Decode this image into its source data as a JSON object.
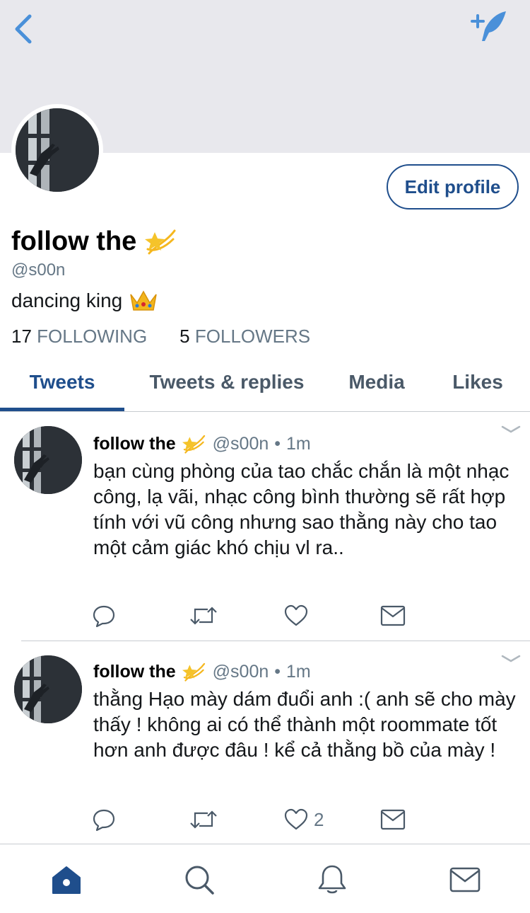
{
  "profile": {
    "display_name": "follow the",
    "handle": "@s00n",
    "bio": "dancing king",
    "following_count": "17",
    "following_label": "FOLLOWING",
    "followers_count": "5",
    "followers_label": "FOLLOWERS",
    "edit_label": "Edit profile"
  },
  "tabs": [
    {
      "label": "Tweets",
      "active": true
    },
    {
      "label": "Tweets & replies",
      "active": false
    },
    {
      "label": "Media",
      "active": false
    },
    {
      "label": "Likes",
      "active": false
    }
  ],
  "tweets": [
    {
      "name": "follow the",
      "handle": "@s00n",
      "dot": "•",
      "time": "1m",
      "text": "bạn cùng phòng của tao chắc chắn là một nhạc công, lạ vãi, nhạc công bình thường sẽ rất hợp tính với vũ công nhưng sao thằng này cho tao một cảm giác khó chịu vl ra..",
      "like_count": ""
    },
    {
      "name": "follow the",
      "handle": "@s00n",
      "dot": "•",
      "time": "1m",
      "text": "thằng Hạo mày dám đuổi anh :( anh sẽ cho mày thấy ! không ai có thể thành một roommate tốt hơn anh được đâu ! kể cả thằng bồ của mày !",
      "like_count": "2"
    }
  ],
  "icons": {
    "back": "chevron-left-icon",
    "compose": "compose-tweet-icon",
    "name_emoji": "dizzy-star-emoji",
    "bio_emoji": "crown-emoji",
    "reply": "reply-icon",
    "retweet": "retweet-icon",
    "like": "heart-icon",
    "dm": "envelope-icon",
    "tab_home": "home-icon",
    "tab_search": "search-icon",
    "tab_notifications": "bell-icon",
    "tab_messages": "envelope-icon"
  },
  "colors": {
    "accent": "#1f4e8c",
    "header_bg": "#e8e8ed",
    "muted": "#657786",
    "icon_blue": "#4a90d9"
  }
}
